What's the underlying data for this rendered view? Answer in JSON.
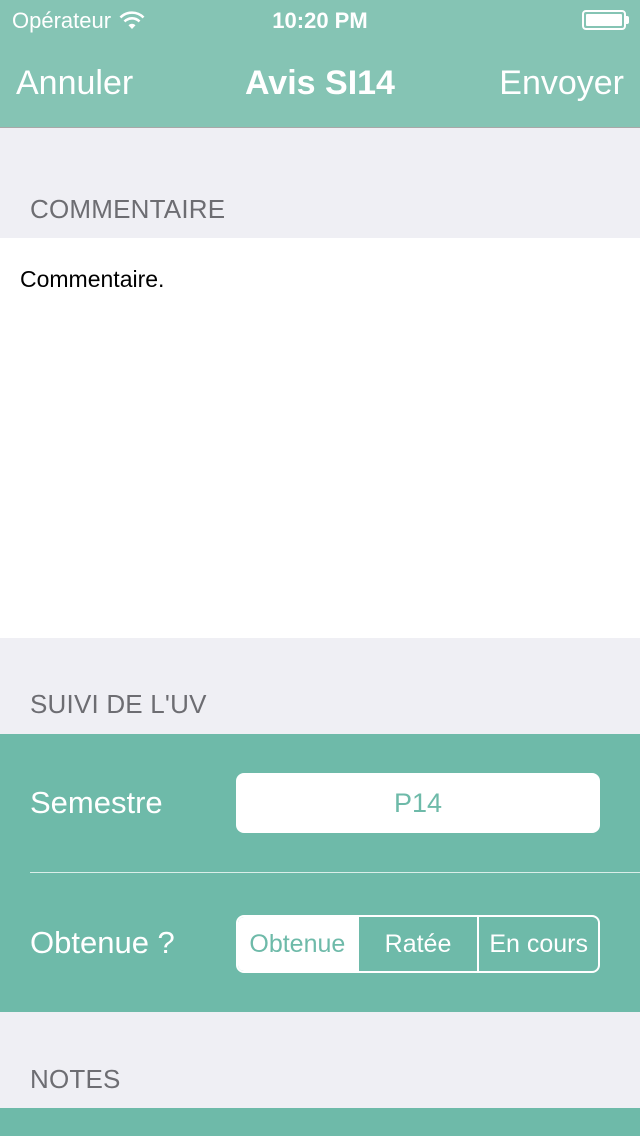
{
  "status_bar": {
    "carrier": "Opérateur",
    "time": "10:20 PM"
  },
  "nav": {
    "cancel_label": "Annuler",
    "title": "Avis SI14",
    "send_label": "Envoyer"
  },
  "sections": {
    "comment_header": "COMMENTAIRE",
    "followup_header": "SUIVI DE L'UV",
    "notes_header": "NOTES"
  },
  "comment": {
    "text": "Commentaire."
  },
  "followup": {
    "semester_label": "Semestre",
    "semester_value": "P14",
    "obtained_label": "Obtenue ?",
    "options": [
      "Obtenue",
      "Ratée",
      "En cours"
    ],
    "selected_option": "Obtenue"
  },
  "colors": {
    "nav_background": "#85c4b4",
    "panel_background": "#6ebaa9",
    "page_background": "#efeff4"
  },
  "icons": {
    "wifi": "wifi-icon",
    "battery": "battery-icon"
  }
}
